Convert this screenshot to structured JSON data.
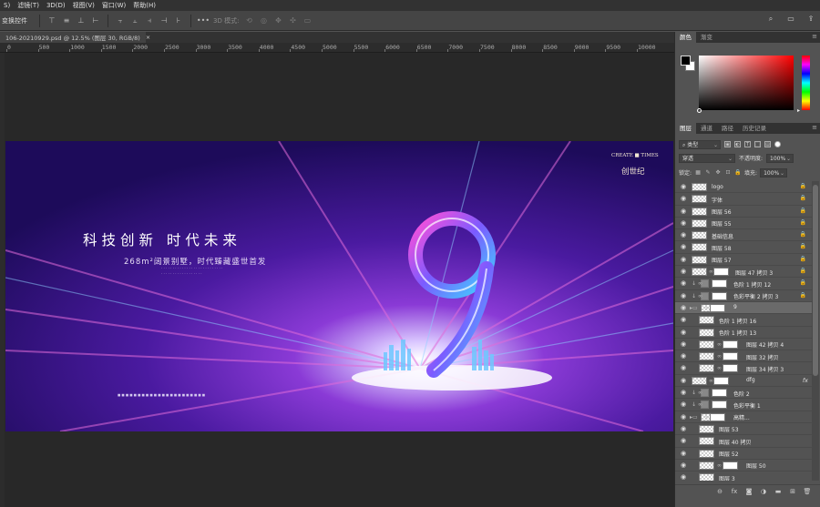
{
  "menubar": {
    "items": [
      "S)",
      "滤镜(T)",
      "3D(D)",
      "视图(V)",
      "窗口(W)",
      "帮助(H)"
    ]
  },
  "options": {
    "tool_label": "变换控件",
    "mode_label": "3D 模式:"
  },
  "document": {
    "tab_title": "106-20210929.psd @ 12.5% (图层 30, RGB/8)",
    "close": "×"
  },
  "ruler": {
    "ticks": [
      "0",
      "500",
      "1000",
      "1500",
      "2000",
      "2500",
      "3000",
      "3500",
      "4000",
      "4500",
      "5000",
      "5500",
      "6000",
      "6500",
      "7000",
      "7500",
      "8000",
      "8500",
      "9000",
      "9500",
      "10000"
    ]
  },
  "artwork": {
    "headline": "科技创新  时代未来",
    "subline": "268m²阔景别墅，时代臻藏盛世首发",
    "tiny_line1": "· · · · · · · · · · · · · · · · · · · · · · · · · · ·",
    "tiny_line2": "· · · · · · · · · · · · · · · · · ·",
    "brand_en": "CREATE ■ TIMES",
    "brand_cn": "创世纪",
    "footer": "■ ■ ■ ■ ■ ■ ■ ■ ■ ■ ■ ■ ■ ■ ■ ■ ■ ■ ■ ■ ■ ■"
  },
  "color_panel": {
    "tabs": [
      "颜色",
      "渐变"
    ]
  },
  "layers_panel": {
    "tabs": [
      "图层",
      "通道",
      "路径",
      "历史记录"
    ],
    "filter": "类型",
    "blend": "穿透",
    "opacity_label": "不透明度:",
    "opacity_value": "100%",
    "lock_label": "锁定:",
    "fill_label": "填充:",
    "fill_value": "100%",
    "layers": [
      {
        "name": "logo",
        "locked": true
      },
      {
        "name": "字体",
        "locked": true
      },
      {
        "name": "图层 56",
        "locked": true
      },
      {
        "name": "图层 55",
        "locked": true
      },
      {
        "name": "基础信息",
        "locked": true
      },
      {
        "name": "图层 58",
        "locked": true
      },
      {
        "name": "图层 57",
        "locked": true
      },
      {
        "name": "图层 47 拷贝 3",
        "locked": true
      },
      {
        "name": "色阶 1 拷贝 12",
        "locked": true
      },
      {
        "name": "色彩平衡 2 拷贝 3",
        "locked": true
      },
      {
        "name": "9",
        "locked": false
      },
      {
        "name": "色阶 1 拷贝 16",
        "locked": false
      },
      {
        "name": "色阶 1 拷贝 13",
        "locked": false
      },
      {
        "name": "图层 42 拷贝 4",
        "locked": false
      },
      {
        "name": "图层 32 拷贝",
        "locked": false
      },
      {
        "name": "图层 34 拷贝 3",
        "locked": false
      },
      {
        "name": "dfg",
        "locked": false
      },
      {
        "name": "色阶 2",
        "locked": false
      },
      {
        "name": "色彩平衡 1",
        "locked": false
      },
      {
        "name": "高精...",
        "locked": false
      },
      {
        "name": "图层 53",
        "locked": false
      },
      {
        "name": "图层 40 拷贝",
        "locked": false
      },
      {
        "name": "图层 52",
        "locked": false
      },
      {
        "name": "图层 50",
        "locked": false
      },
      {
        "name": "图层 3",
        "locked": false
      }
    ],
    "fx_label": "fx"
  }
}
